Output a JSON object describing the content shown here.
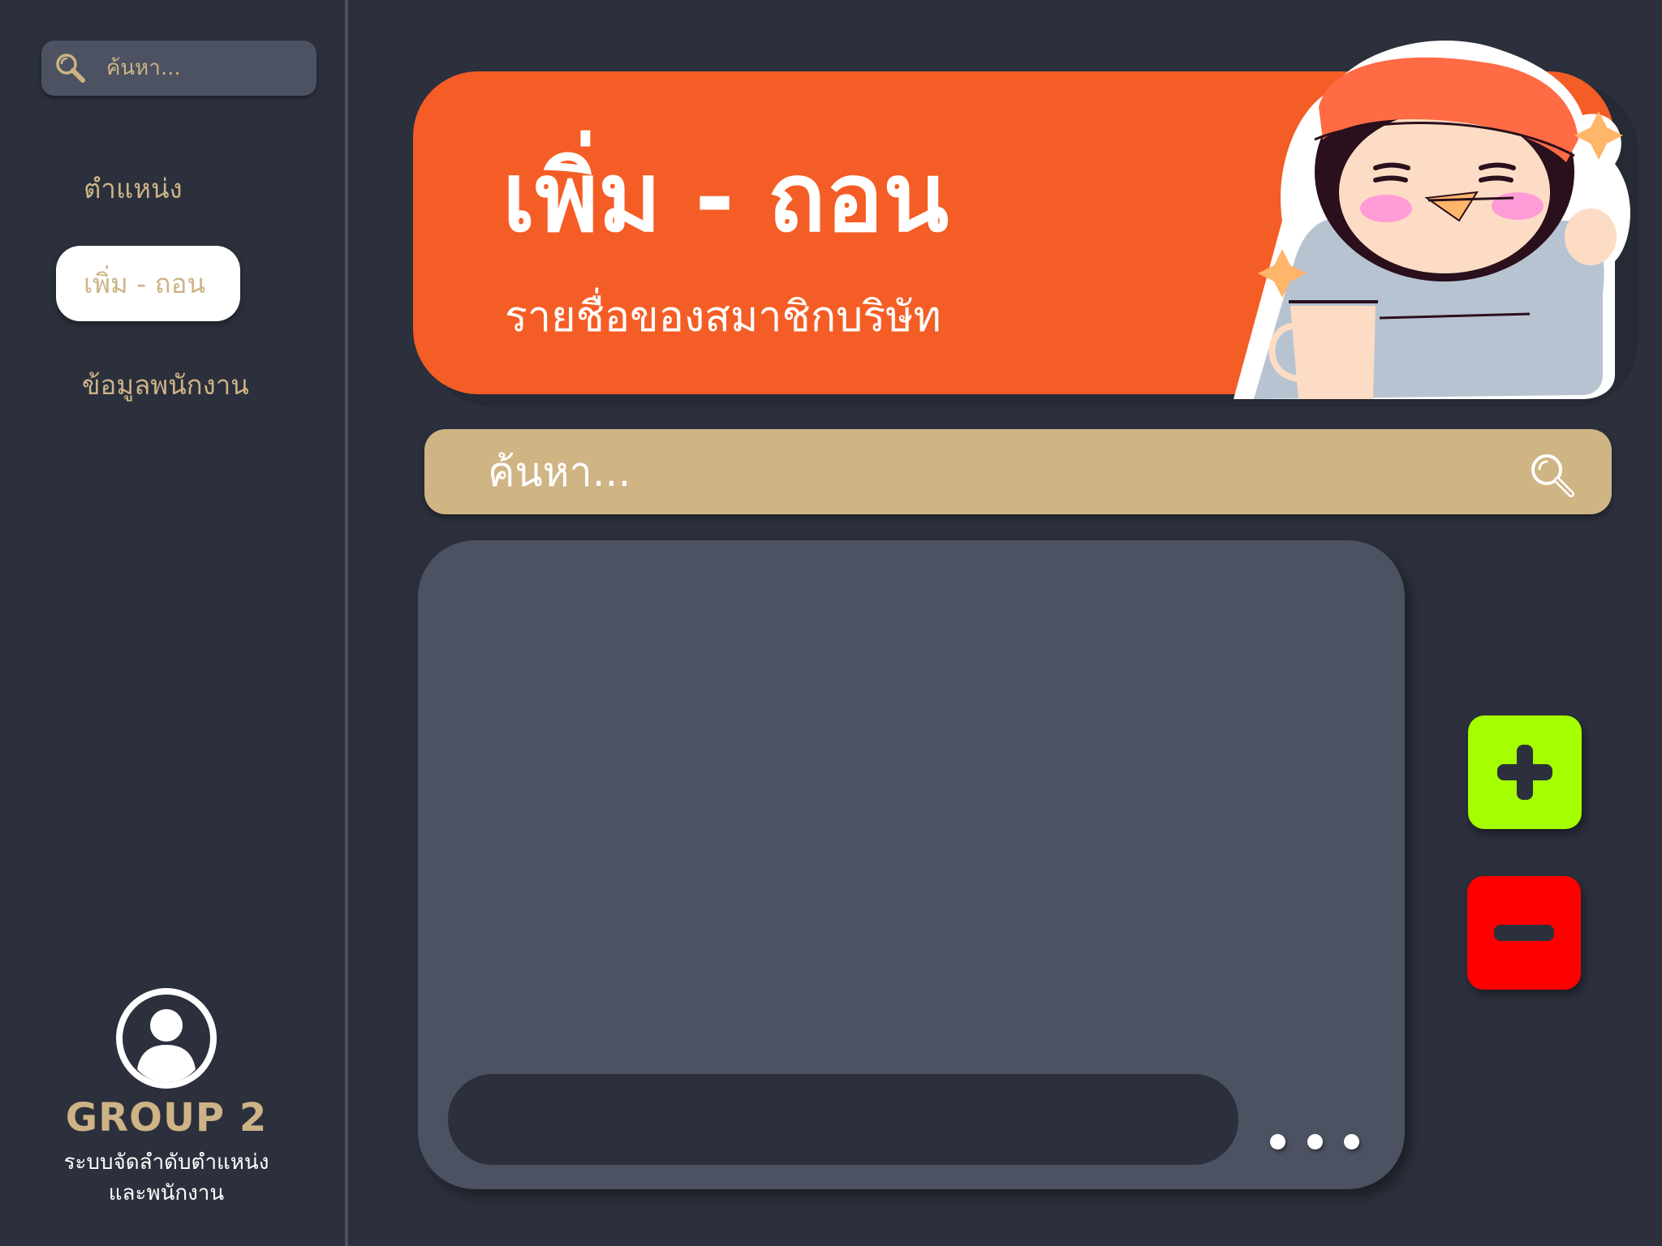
{
  "sidebar": {
    "search": {
      "placeholder": "ค้นหา..."
    },
    "nav": {
      "positions_label": "ตำแหน่ง",
      "add_remove_label": "เพิ่ม - ถอน",
      "employee_info_label": "ข้อมูลพนักงาน"
    },
    "profile": {
      "group_name": "GROUP 2",
      "description_line1": "ระบบจัดลำดับตำแหน่ง",
      "description_line2": "และพนักงาน"
    }
  },
  "banner": {
    "title": "เพิ่ม - ถอน",
    "subtitle": "รายชื่อของสมาชิกบริษัท",
    "mascot": "penguin-with-santa-hat-and-cup"
  },
  "main_search": {
    "placeholder": "ค้นหา..."
  },
  "panel": {
    "input_value": "",
    "more_icon": "ellipsis-icon"
  },
  "actions": {
    "add_icon": "plus-icon",
    "remove_icon": "minus-icon"
  },
  "colors": {
    "background": "#2b303c",
    "sidebar_text": "#cdb386",
    "banner": "#f45d25",
    "search_bar": "#cfb484",
    "panel": "#4c5261",
    "add_button": "#a5ff00",
    "remove_button": "#ff0000"
  }
}
